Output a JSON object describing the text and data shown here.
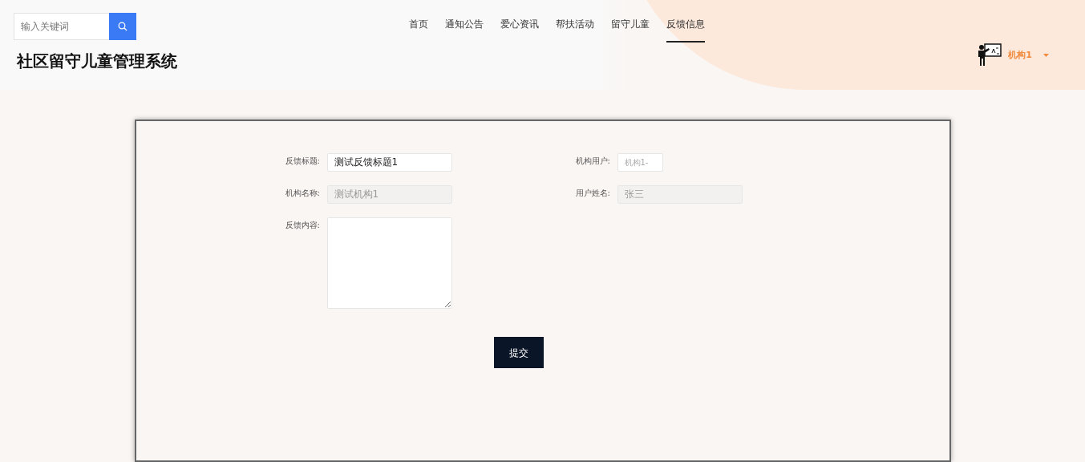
{
  "search": {
    "placeholder": "输入关键词"
  },
  "nav": [
    {
      "label": "首页",
      "selected": false
    },
    {
      "label": "通知公告",
      "selected": false
    },
    {
      "label": "爱心资讯",
      "selected": false
    },
    {
      "label": "帮扶活动",
      "selected": false
    },
    {
      "label": "留守儿童",
      "selected": false
    },
    {
      "label": "反馈信息",
      "selected": true
    }
  ],
  "site_title": "社区留守儿童管理系统",
  "user": {
    "name": "机构1"
  },
  "form": {
    "fields": [
      {
        "label": "反馈标题:",
        "kind": "text",
        "value": "测试反馈标题1",
        "disabled": false
      },
      {
        "label": "机构用户:",
        "kind": "text",
        "placeholder": "机构1-",
        "disabled": false
      },
      {
        "label": "机构名称:",
        "kind": "text",
        "value": "测试机构1",
        "disabled": true
      },
      {
        "label": "用户姓名:",
        "kind": "text",
        "value": "张三",
        "disabled": true
      },
      {
        "label": "反馈内容:",
        "kind": "textarea",
        "disabled": false
      }
    ],
    "submit": "提交"
  }
}
